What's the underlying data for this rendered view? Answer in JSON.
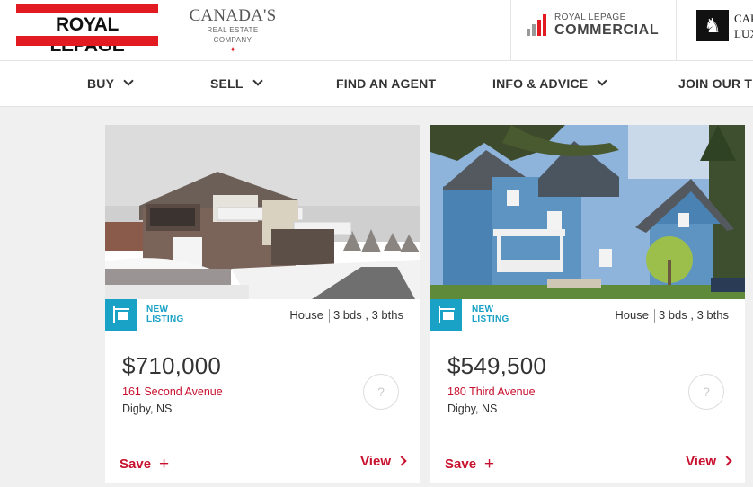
{
  "header": {
    "brand_logo_text": "ROYAL LEPAGE",
    "tagline_main": "CANADA'S",
    "tagline_sub": "REAL ESTATE COMPANY",
    "commercial_top": "ROYAL LEPAGE",
    "commercial_main": "COMMERCIAL",
    "luxury_text": "CAR\nLUX"
  },
  "nav": {
    "items": [
      {
        "label": "BUY",
        "has_dropdown": true
      },
      {
        "label": "SELL",
        "has_dropdown": true
      },
      {
        "label": "FIND AN AGENT",
        "has_dropdown": false
      },
      {
        "label": "INFO & ADVICE",
        "has_dropdown": true
      },
      {
        "label": "JOIN OUR TE",
        "has_dropdown": false
      }
    ]
  },
  "listings": [
    {
      "badge_line1": "NEW",
      "badge_line2": "LISTING",
      "type": "House",
      "beds_baths": "3 bds , 3 bths",
      "price": "$710,000",
      "address": "161 Second Avenue",
      "city": "Digby, NS",
      "favourite_icon": "?",
      "save_label": "Save",
      "view_label": "View"
    },
    {
      "badge_line1": "NEW",
      "badge_line2": "LISTING",
      "type": "House",
      "beds_baths": "3 bds , 3 bths",
      "price": "$549,500",
      "address": "180 Third Avenue",
      "city": "Digby, NS",
      "favourite_icon": "?",
      "save_label": "Save",
      "view_label": "View"
    }
  ],
  "colors": {
    "brand_red": "#e21b23",
    "link_red": "#c8102e",
    "accent_blue": "#19a1c6"
  }
}
